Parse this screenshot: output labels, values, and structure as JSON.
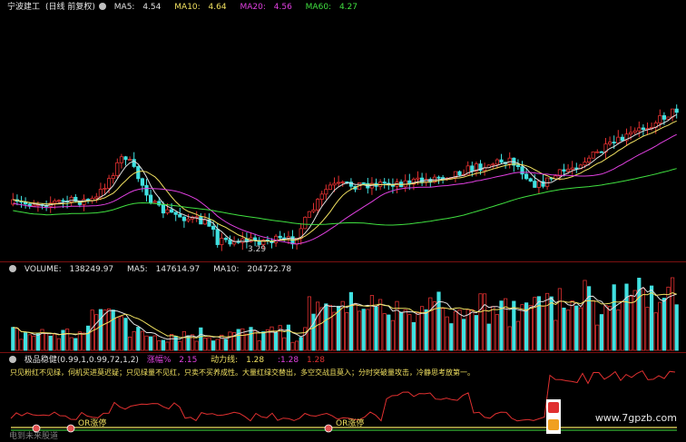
{
  "price_panel": {
    "title": "宁波建工",
    "mode": "(日线 前复权)",
    "ma": [
      {
        "label": "MA5:",
        "value": "4.54",
        "color": "#e0e0e0"
      },
      {
        "label": "MA10:",
        "value": "4.64",
        "color": "#f0e060"
      },
      {
        "label": "MA20:",
        "value": "4.56",
        "color": "#e040e0"
      },
      {
        "label": "MA60:",
        "value": "4.27",
        "color": "#40e040"
      }
    ],
    "low_label": "3.29"
  },
  "volume_panel": {
    "label": "VOLUME:",
    "value": "138249.97",
    "ma5_label": "MA5:",
    "ma5_value": "147614.97",
    "ma10_label": "MA10:",
    "ma10_value": "204722.78"
  },
  "indicator_panel": {
    "name": "极品稳健",
    "params": "(0.99,1,0.99,72,1,2)",
    "zf_label": "涨幅%",
    "zf_value": "2.15",
    "dl_label": "动力线:",
    "dl_value": "1.28",
    "v1": ":1.28",
    "v2": "1.28",
    "motto": "只见粉红不见绿，伺机买进莫迟疑；只见绿量不见红，只卖不买养成性。大量红绿交替出，多空交战且莫入；分时突破量攻击，冷静思考放第一。",
    "signal1": "OR涨停",
    "signal2": "OR涨停",
    "footer": "电到未来股道"
  },
  "watermark": "www.7gpzb.com",
  "colors": {
    "up": "#e03030",
    "down": "#40e0e0",
    "ma5": "#e0e0e0",
    "ma10": "#f0e060",
    "ma20": "#e040e0",
    "ma60": "#40e040",
    "header": "#d0d0d0",
    "text_yellow": "#f0e060",
    "grid": "#7a1010"
  },
  "icons": [
    "gear-icon",
    "settings-icon",
    "settings-icon-2"
  ]
}
